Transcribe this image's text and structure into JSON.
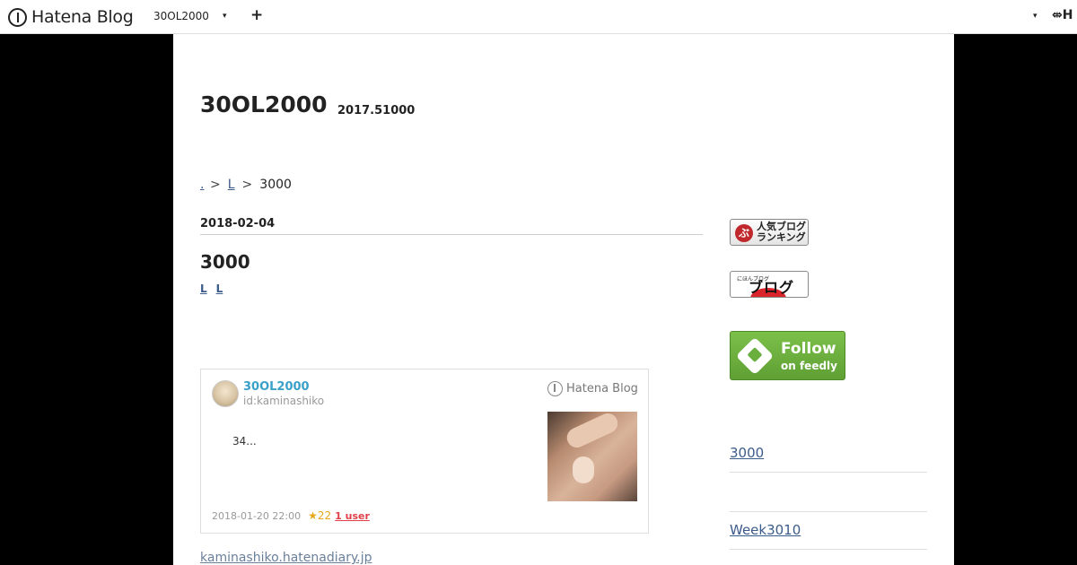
{
  "globalheader": {
    "logo_text": "Hatena Blog",
    "blog_name": "30OL2000",
    "caret": "▾",
    "plus": "+",
    "user_caret": "▾",
    "user_text": "⇎H"
  },
  "blog": {
    "title": "30OL2000",
    "description": "2017.51000"
  },
  "breadcrumb": {
    "items": [
      {
        "label": "."
      },
      {
        "label": "L"
      }
    ],
    "separator": ">",
    "current": "3000"
  },
  "entry": {
    "date": "2018-02-04",
    "title": "3000",
    "categories": [
      "L",
      "L  "
    ]
  },
  "embed_card": {
    "author": "30OL2000",
    "id": "id:kaminashiko",
    "brand": "Hatena Blog",
    "excerpt": "34...",
    "timestamp": "2018-01-20 22:00",
    "star": "★",
    "stars": "22",
    "users": "1 user"
  },
  "source_link": "kaminashiko.hatenadiary.jp",
  "sidebar": {
    "ranking_icon": "ぶ",
    "ranking_text": "人気ブログランキング",
    "village_small": "にほんブログ",
    "village_text": "ブログ村",
    "feedly_follow": "Follow",
    "feedly_on": "on feedly",
    "links": [
      {
        "label": "3000     "
      },
      {
        "label": "Week3010  "
      }
    ]
  },
  "colors": {
    "link": "#3b5b8b",
    "author": "#3aa0c8",
    "feedly_green": "#6aae3d",
    "ranking_red": "#c0282d"
  }
}
